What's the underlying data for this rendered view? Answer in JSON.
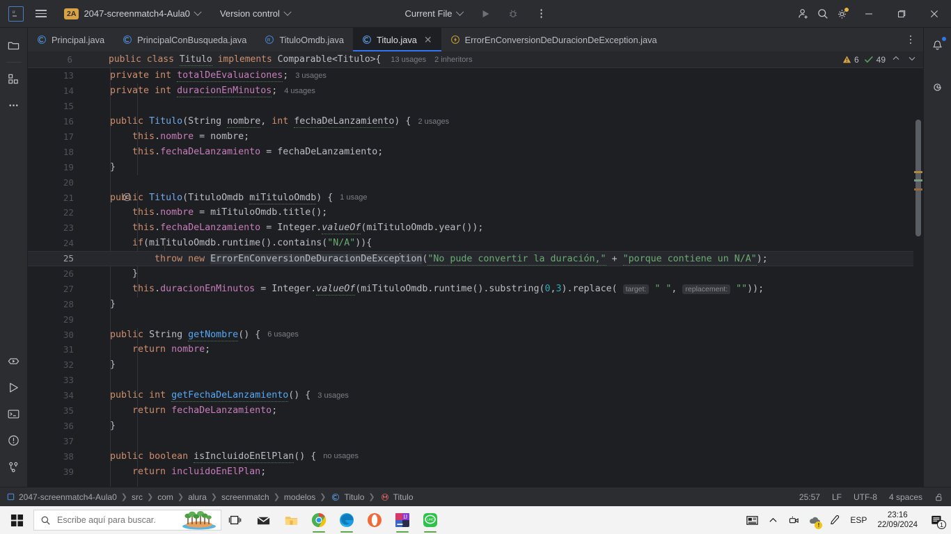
{
  "titlebar": {
    "logo_text": "IJ",
    "project_badge": "2A",
    "project_name": "2047-screenmatch4-Aula0",
    "vcs_label": "Version control",
    "run_config": "Current File",
    "run_icon": "run-icon",
    "debug_icon": "debug-icon",
    "more_icon": "more-options-icon",
    "account_icon": "add-account-icon",
    "search_icon": "search-icon",
    "settings_icon": "settings-gear-icon",
    "minimize_icon": "minimize-icon",
    "maximize_icon": "maximize-restore-icon",
    "close_icon": "close-icon"
  },
  "left_stripe": {
    "items": [
      {
        "name": "project-tool-window",
        "icon": "folder-icon"
      },
      {
        "name": "structure-tool-window",
        "icon": "structure-icon"
      },
      {
        "name": "more-tool-windows",
        "icon": "ellipsis-icon"
      }
    ],
    "bottom_items": [
      {
        "name": "services-tool-window",
        "icon": "services-icon"
      },
      {
        "name": "run-tool-window",
        "icon": "run-triangle-icon"
      },
      {
        "name": "terminal-tool-window",
        "icon": "terminal-icon"
      },
      {
        "name": "problems-tool-window",
        "icon": "problems-icon"
      },
      {
        "name": "version-control-tool-window",
        "icon": "branch-icon"
      }
    ]
  },
  "right_stripe": {
    "items": [
      {
        "name": "notifications-tool-window",
        "icon": "bell-icon"
      },
      {
        "name": "ai-assistant-tool-window",
        "icon": "spiral-icon"
      }
    ]
  },
  "tabs": [
    {
      "label": "Principal.java",
      "icon": "java-class-icon",
      "active": false,
      "closable": false
    },
    {
      "label": "PrincipalConBusqueda.java",
      "icon": "java-class-icon",
      "active": false,
      "closable": false
    },
    {
      "label": "TituloOmdb.java",
      "icon": "java-record-icon",
      "active": false,
      "closable": false
    },
    {
      "label": "Titulo.java",
      "icon": "java-class-icon",
      "active": true,
      "closable": true
    },
    {
      "label": "ErrorEnConversionDeDuracionDeException.java",
      "icon": "java-exception-icon",
      "active": false,
      "closable": false
    }
  ],
  "tabbar_more_icon": "tab-list-options-icon",
  "sticky_header": {
    "line_number": "6",
    "code": "public class Titulo implements Comparable<Titulo>{",
    "usages": "13 usages",
    "inheritors": "2 inheritors",
    "warning_count": "6",
    "ok_count": "49",
    "prev_icon": "previous-highlight-icon",
    "next_icon": "next-highlight-icon"
  },
  "editor": {
    "caret_position": "25:57",
    "lines": [
      {
        "n": "13",
        "text": "    private int totalDeEvaluaciones;   3 usages"
      },
      {
        "n": "14",
        "text": "    private int duracionEnMinutos;   4 usages"
      },
      {
        "n": "15",
        "text": ""
      },
      {
        "n": "16",
        "text": "    public Titulo(String nombre, int fechaDeLanzamiento) {  2 usages"
      },
      {
        "n": "17",
        "text": "        this.nombre = nombre;"
      },
      {
        "n": "18",
        "text": "        this.fechaDeLanzamiento = fechaDeLanzamiento;"
      },
      {
        "n": "19",
        "text": "    }"
      },
      {
        "n": "20",
        "text": ""
      },
      {
        "n": "21",
        "text": "    public Titulo(TituloOmdb miTituloOmdb) {  1 usage",
        "gutter": "override-icon"
      },
      {
        "n": "22",
        "text": "        this.nombre = miTituloOmdb.title();"
      },
      {
        "n": "23",
        "text": "        this.fechaDeLanzamiento = Integer.valueOf(miTituloOmdb.year());"
      },
      {
        "n": "24",
        "text": "        if(miTituloOmdb.runtime().contains(\"N/A\")){"
      },
      {
        "n": "25",
        "text": "            throw new ErrorEnConversionDeDuracionDeException(\"No pude convertir la duración,\" + \"porque contiene un N/A\");",
        "current": true
      },
      {
        "n": "26",
        "text": "        }"
      },
      {
        "n": "27",
        "text": "        this.duracionEnMinutos = Integer.valueOf(miTituloOmdb.runtime().substring(0,3).replace( target: \" \",  replacement: \"\"));"
      },
      {
        "n": "28",
        "text": "    }"
      },
      {
        "n": "29",
        "text": ""
      },
      {
        "n": "30",
        "text": "    public String getNombre() {  6 usages"
      },
      {
        "n": "31",
        "text": "        return nombre;"
      },
      {
        "n": "32",
        "text": "    }"
      },
      {
        "n": "33",
        "text": ""
      },
      {
        "n": "34",
        "text": "    public int getFechaDeLanzamiento() {  3 usages"
      },
      {
        "n": "35",
        "text": "        return fechaDeLanzamiento;"
      },
      {
        "n": "36",
        "text": "    }"
      },
      {
        "n": "37",
        "text": ""
      },
      {
        "n": "38",
        "text": "    public boolean isIncluidoEnElPlan() {  no usages"
      },
      {
        "n": "39",
        "text": "        return incluidoEnElPlan;"
      }
    ],
    "hint_labels": {
      "target": "target:",
      "replacement": "replacement:"
    },
    "usage_labels": {
      "l13": "3 usages",
      "l14": "4 usages",
      "l16": "2 usages",
      "l21": "1 usage",
      "l30": "6 usages",
      "l34": "3 usages",
      "l38": "no usages"
    }
  },
  "statusbar": {
    "breadcrumbs": [
      "2047-screenmatch4-Aula0",
      "src",
      "com",
      "alura",
      "screenmatch",
      "modelos",
      "Titulo",
      "Titulo"
    ],
    "caret": "25:57",
    "line_separator": "LF",
    "encoding": "UTF-8",
    "indent": "4 spaces",
    "lock_icon": "unlocked-padlock-icon",
    "project_icon": "module-icon",
    "class_icon": "java-class-icon",
    "method_icon": "java-method-icon"
  },
  "taskbar": {
    "start_icon": "windows-start-icon",
    "search_placeholder": "Escribe aquí para buscar.",
    "search_value": "",
    "search_icon": "magnifier-icon",
    "weather_icon": "trees-island-icon",
    "apps": [
      {
        "name": "task-view",
        "icon": "task-view-icon"
      },
      {
        "name": "mail",
        "icon": "mail-icon"
      },
      {
        "name": "file-explorer",
        "icon": "folder-icon"
      },
      {
        "name": "google-chrome",
        "icon": "chrome-icon"
      },
      {
        "name": "microsoft-edge",
        "icon": "edge-icon"
      },
      {
        "name": "opera",
        "icon": "opera-icon"
      },
      {
        "name": "intellij-idea",
        "icon": "intellij-icon"
      },
      {
        "name": "line",
        "icon": "line-icon"
      }
    ],
    "tray": {
      "news_icon": "news-and-interests-icon",
      "chevron_icon": "show-hidden-icons-icon",
      "meet_icon": "camera-icon",
      "onedrive_icon": "onedrive-warning-icon",
      "pen_icon": "pen-icon",
      "language": "ESP",
      "time": "23:16",
      "date": "22/09/2024",
      "notification_count": "1",
      "notification_icon": "action-center-icon"
    }
  },
  "colors": {
    "accent": "#3574f0",
    "badge": "#d9a343",
    "string": "#6aab73",
    "keyword": "#cf8e6d",
    "field": "#c77dbb",
    "number": "#2aacb8",
    "bg_editor": "#1e1f22",
    "bg_chrome": "#2b2d30"
  }
}
